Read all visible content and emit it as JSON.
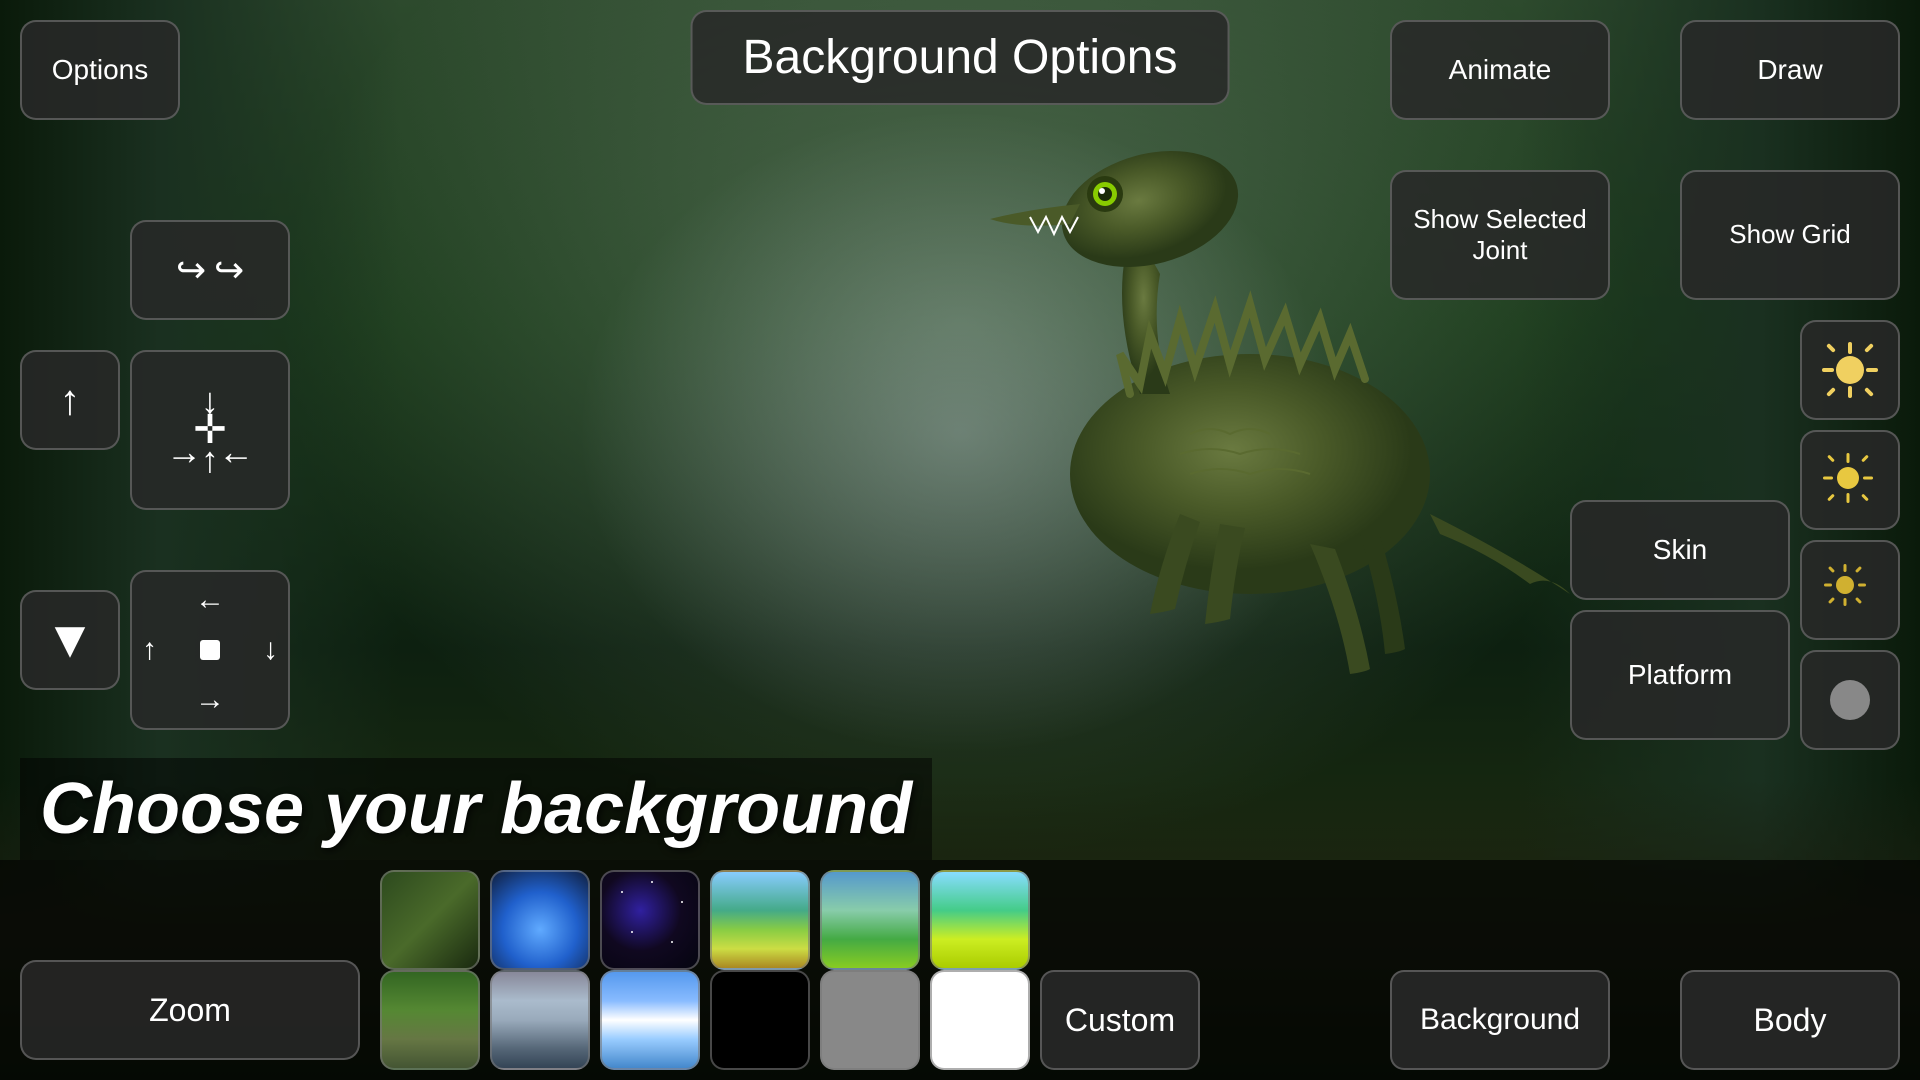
{
  "header": {
    "title": "Background Options",
    "options_label": "Options",
    "animate_label": "Animate",
    "draw_label": "Draw"
  },
  "right_panel": {
    "show_selected_joint_label": "Show Selected Joint",
    "show_grid_label": "Show Grid",
    "skin_label": "Skin",
    "platform_label": "Platform"
  },
  "bottom_panel": {
    "choose_bg_text": "Choose your background",
    "zoom_label": "Zoom",
    "custom_label": "Custom",
    "background_label": "Background",
    "body_label": "Body"
  },
  "sun_buttons": [
    {
      "id": "sun1",
      "size": "large"
    },
    {
      "id": "sun2",
      "size": "medium"
    },
    {
      "id": "sun3",
      "size": "small"
    }
  ],
  "thumbnails_row1": [
    {
      "id": "t1",
      "style": "forest",
      "label": "Forest"
    },
    {
      "id": "t2",
      "style": "blue-sky",
      "label": "Blue sky"
    },
    {
      "id": "t3",
      "style": "space",
      "label": "Space"
    },
    {
      "id": "t4",
      "style": "green-sky",
      "label": "Green sky"
    },
    {
      "id": "t5",
      "style": "green-sky2",
      "label": "Green hills"
    },
    {
      "id": "t6",
      "style": "yellow-green",
      "label": "Yellow green"
    }
  ],
  "thumbnails_row2": [
    {
      "id": "t7",
      "style": "waterfall",
      "label": "Waterfall"
    },
    {
      "id": "t8",
      "style": "mountain",
      "label": "Mountain"
    },
    {
      "id": "t9",
      "style": "clouds",
      "label": "Clouds"
    },
    {
      "id": "t10",
      "style": "black",
      "label": "Black"
    },
    {
      "id": "t11",
      "style": "gray",
      "label": "Gray"
    },
    {
      "id": "t12",
      "style": "white",
      "label": "White"
    }
  ],
  "colors": {
    "bg_button": "rgba(40,40,40,0.85)",
    "border": "rgba(120,120,120,0.6)",
    "text": "white",
    "sun_color": "#f0d060"
  }
}
